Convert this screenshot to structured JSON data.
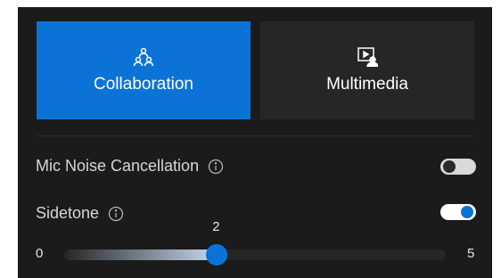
{
  "modes": {
    "collaboration": {
      "label": "Collaboration",
      "icon": "people-group-icon",
      "active": true
    },
    "multimedia": {
      "label": "Multimedia",
      "icon": "media-presenter-icon",
      "active": false
    }
  },
  "settings": {
    "mic_noise_cancellation": {
      "label": "Mic Noise Cancellation",
      "icon": "info-icon",
      "enabled": false
    },
    "sidetone": {
      "label": "Sidetone",
      "icon": "info-icon",
      "enabled": true
    }
  },
  "sidetone_slider": {
    "min": "0",
    "max": "5",
    "value": "2"
  },
  "colors": {
    "accent": "#0b73d6",
    "panel": "#1b1b1b",
    "card_inactive": "#262626"
  }
}
